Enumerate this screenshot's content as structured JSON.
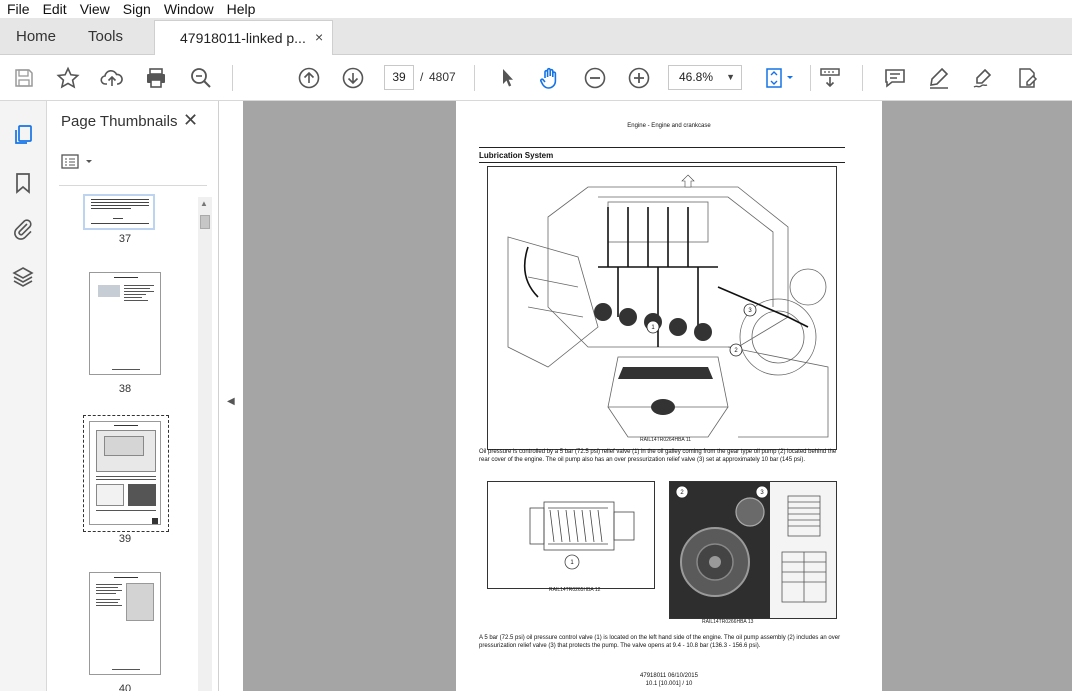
{
  "menu": [
    "File",
    "Edit",
    "View",
    "Sign",
    "Window",
    "Help"
  ],
  "tabs": {
    "home": "Home",
    "tools": "Tools",
    "document": "47918011-linked p...",
    "close": "×"
  },
  "toolbar": {
    "page_current": "39",
    "page_separator": "/",
    "page_total": "4807",
    "zoom": "46.8%",
    "icons": [
      "save-icon",
      "star-icon",
      "upload-icon",
      "print-icon",
      "search-zoom-icon",
      "page-up-icon",
      "page-down-icon",
      "select-arrow-icon",
      "hand-icon",
      "zoom-out-icon",
      "zoom-in-icon",
      "fit-page-icon",
      "scroll-mode-icon",
      "comment-icon",
      "highlight-pen-icon",
      "sign-icon",
      "edit-pdf-icon"
    ],
    "accent_color": "#1473e6"
  },
  "rail": {
    "icons": [
      "page-thumbnails-icon",
      "bookmark-icon",
      "attachment-icon",
      "layers-icon"
    ]
  },
  "thumbnails_panel": {
    "title": "Page Thumbnails",
    "close": "✕",
    "items": [
      {
        "label": "37"
      },
      {
        "label": "38"
      },
      {
        "label": "39"
      },
      {
        "label": "40"
      }
    ]
  },
  "document": {
    "header": "Engine - Engine and crankcase",
    "section_title": "Lubrication System",
    "fig1_caption": "RAIL14TR0264HBA   11",
    "para1": "Oil pressure is controlled by a 5 bar (72.5 psi) relief valve (1) in the oil galley coming from the gear type oil pump (2) located behind the rear cover of the engine. The oil pump also has an over pressurization relief valve (3) set at approximately 10 bar (145 psi).",
    "fig2_caption": "RAIL14TR0265HBA   12",
    "fig3_caption": "RAIL14TR0266HBA   13",
    "para2": "A 5 bar (72.5 psi) oil pressure control valve (1) is located on the left hand side of the engine. The oil pump assembly (2) includes an over pressurization relief valve (3) that protects the pump. The valve opens at 9.4 - 10.8 bar (136.3 - 156.6 psi).",
    "footer1": "47918011 06/10/2015",
    "footer2": "10.1 [10.001] / 10",
    "callouts": [
      "1",
      "2",
      "3"
    ]
  }
}
